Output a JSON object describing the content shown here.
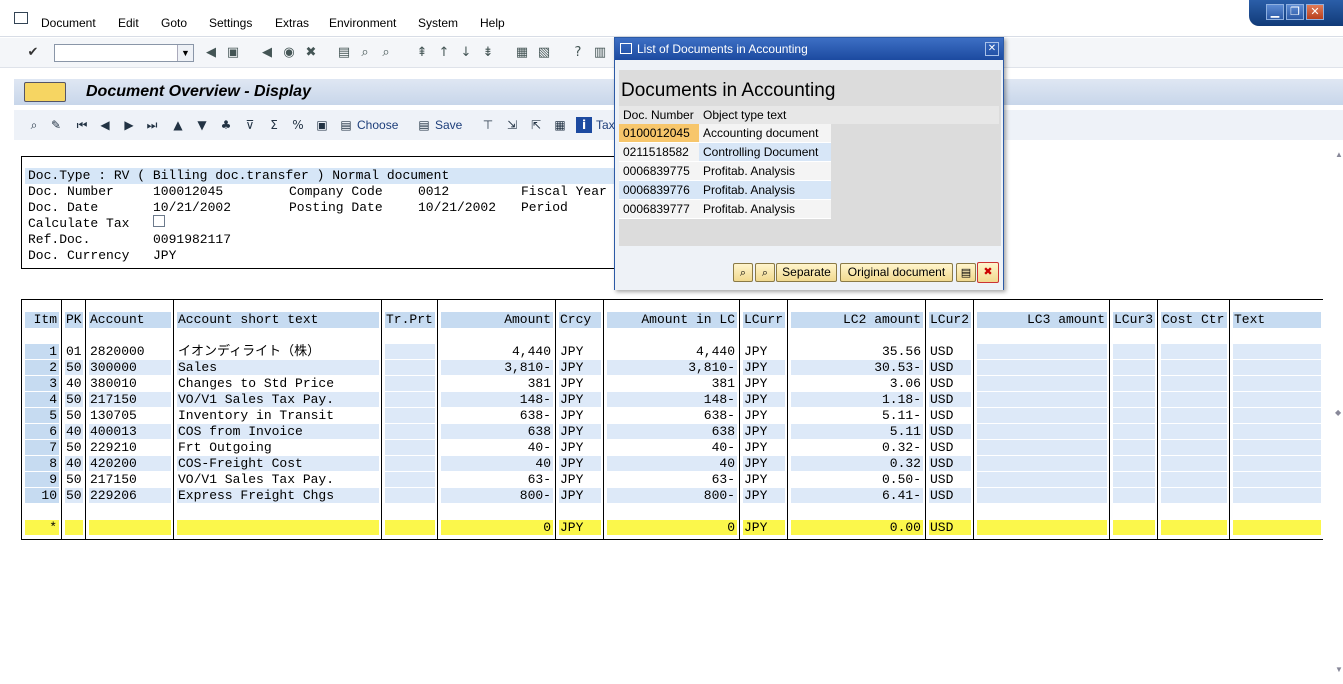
{
  "menu": [
    "Document",
    "Edit",
    "Goto",
    "Settings",
    "Extras",
    "Environment",
    "System",
    "Help"
  ],
  "window_controls": {
    "minimize": "▁",
    "restore": "❐",
    "close": "✕"
  },
  "screen": {
    "title": "Document Overview - Display"
  },
  "app_toolbar": {
    "choose_label": "Choose",
    "save_label": "Save",
    "tax_label": "Tax"
  },
  "doc_header": {
    "banner": "Doc.Type : RV ( Billing doc.transfer ) Normal document",
    "doc_number_label": "Doc. Number",
    "doc_number": "100012045",
    "company_code_label": "Company Code",
    "company_code": "0012",
    "fiscal_year_label": "Fiscal Year",
    "doc_date_label": "Doc. Date",
    "doc_date": "10/21/2002",
    "posting_date_label": "Posting Date",
    "posting_date": "10/21/2002",
    "period_label": "Period",
    "calc_tax_label": "Calculate Tax",
    "ref_doc_label": "Ref.Doc.",
    "ref_doc": "0091982117",
    "currency_label": "Doc. Currency",
    "currency": "JPY"
  },
  "grid": {
    "headers": [
      "Itm",
      "PK",
      "Account",
      "Account short text",
      "Tr.Prt",
      "Amount",
      "Crcy",
      "Amount in LC",
      "LCurr",
      "LC2 amount",
      "LCur2",
      "LC3 amount",
      "LCur3",
      "Cost Ctr",
      "Text"
    ],
    "rows": [
      {
        "itm": "1",
        "pk": "01",
        "account": "2820000",
        "text": "イオンディライト（株）",
        "amount": "4,440",
        "crcy": "JPY",
        "amount_lc": "4,440",
        "lcurr": "JPY",
        "lc2": "35.56",
        "lcur2": "USD"
      },
      {
        "itm": "2",
        "pk": "50",
        "account": "300000",
        "text": "Sales",
        "amount": "3,810-",
        "crcy": "JPY",
        "amount_lc": "3,810-",
        "lcurr": "JPY",
        "lc2": "30.53-",
        "lcur2": "USD"
      },
      {
        "itm": "3",
        "pk": "40",
        "account": "380010",
        "text": "Changes to Std Price",
        "amount": "381",
        "crcy": "JPY",
        "amount_lc": "381",
        "lcurr": "JPY",
        "lc2": "3.06",
        "lcur2": "USD"
      },
      {
        "itm": "4",
        "pk": "50",
        "account": "217150",
        "text": "VO/V1 Sales Tax Pay.",
        "amount": "148-",
        "crcy": "JPY",
        "amount_lc": "148-",
        "lcurr": "JPY",
        "lc2": "1.18-",
        "lcur2": "USD"
      },
      {
        "itm": "5",
        "pk": "50",
        "account": "130705",
        "text": "Inventory in Transit",
        "amount": "638-",
        "crcy": "JPY",
        "amount_lc": "638-",
        "lcurr": "JPY",
        "lc2": "5.11-",
        "lcur2": "USD"
      },
      {
        "itm": "6",
        "pk": "40",
        "account": "400013",
        "text": "COS from Invoice",
        "amount": "638",
        "crcy": "JPY",
        "amount_lc": "638",
        "lcurr": "JPY",
        "lc2": "5.11",
        "lcur2": "USD"
      },
      {
        "itm": "7",
        "pk": "50",
        "account": "229210",
        "text": "Frt Outgoing",
        "amount": "40-",
        "crcy": "JPY",
        "amount_lc": "40-",
        "lcurr": "JPY",
        "lc2": "0.32-",
        "lcur2": "USD"
      },
      {
        "itm": "8",
        "pk": "40",
        "account": "420200",
        "text": "COS-Freight Cost",
        "amount": "40",
        "crcy": "JPY",
        "amount_lc": "40",
        "lcurr": "JPY",
        "lc2": "0.32",
        "lcur2": "USD"
      },
      {
        "itm": "9",
        "pk": "50",
        "account": "217150",
        "text": "VO/V1 Sales Tax Pay.",
        "amount": "63-",
        "crcy": "JPY",
        "amount_lc": "63-",
        "lcurr": "JPY",
        "lc2": "0.50-",
        "lcur2": "USD"
      },
      {
        "itm": "10",
        "pk": "50",
        "account": "229206",
        "text": "Express Freight Chgs",
        "amount": "800-",
        "crcy": "JPY",
        "amount_lc": "800-",
        "lcurr": "JPY",
        "lc2": "6.41-",
        "lcur2": "USD"
      }
    ],
    "total": {
      "itm": "*",
      "amount": "0",
      "crcy": "JPY",
      "amount_lc": "0",
      "lcurr": "JPY",
      "lc2": "0.00",
      "lcur2": "USD"
    }
  },
  "dialog": {
    "title": "List of Documents in Accounting",
    "heading": "Documents in Accounting",
    "col_doc_number": "Doc. Number",
    "col_object_type": "Object type text",
    "rows": [
      {
        "doc": "0100012045",
        "type": "Accounting document"
      },
      {
        "doc": "0211518582",
        "type": "Controlling Document"
      },
      {
        "doc": "0006839775",
        "type": "Profitab. Analysis"
      },
      {
        "doc": "0006839776",
        "type": "Profitab. Analysis"
      },
      {
        "doc": "0006839777",
        "type": "Profitab. Analysis"
      }
    ],
    "separate_label": "Separate",
    "original_label": "Original document",
    "selected_color": "#f7c66b"
  }
}
